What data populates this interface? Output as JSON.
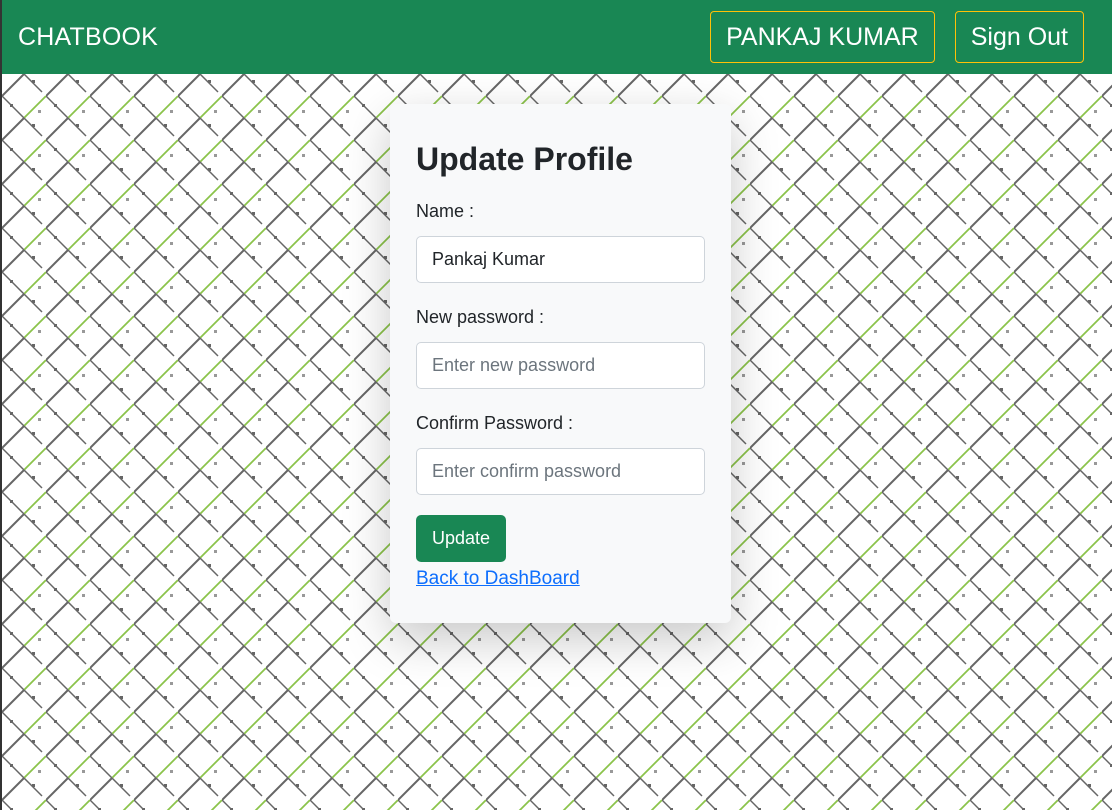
{
  "navbar": {
    "brand": "CHATBOOK",
    "user_label": "PANKAJ KUMAR",
    "signout_label": "Sign Out"
  },
  "form": {
    "title": "Update Profile",
    "name_label": "Name :",
    "name_value": "Pankaj Kumar",
    "new_password_label": "New password :",
    "new_password_placeholder": "Enter new password",
    "confirm_password_label": "Confirm Password :",
    "confirm_password_placeholder": "Enter confirm password",
    "submit_label": "Update",
    "back_link": "Back to DashBoard"
  },
  "colors": {
    "navbar": "#198754",
    "nav_border": "#ffc107",
    "card_bg": "#f8f9fa",
    "link": "#0d6efd",
    "pattern_green": "#8bc34a",
    "pattern_gray": "#666666"
  }
}
